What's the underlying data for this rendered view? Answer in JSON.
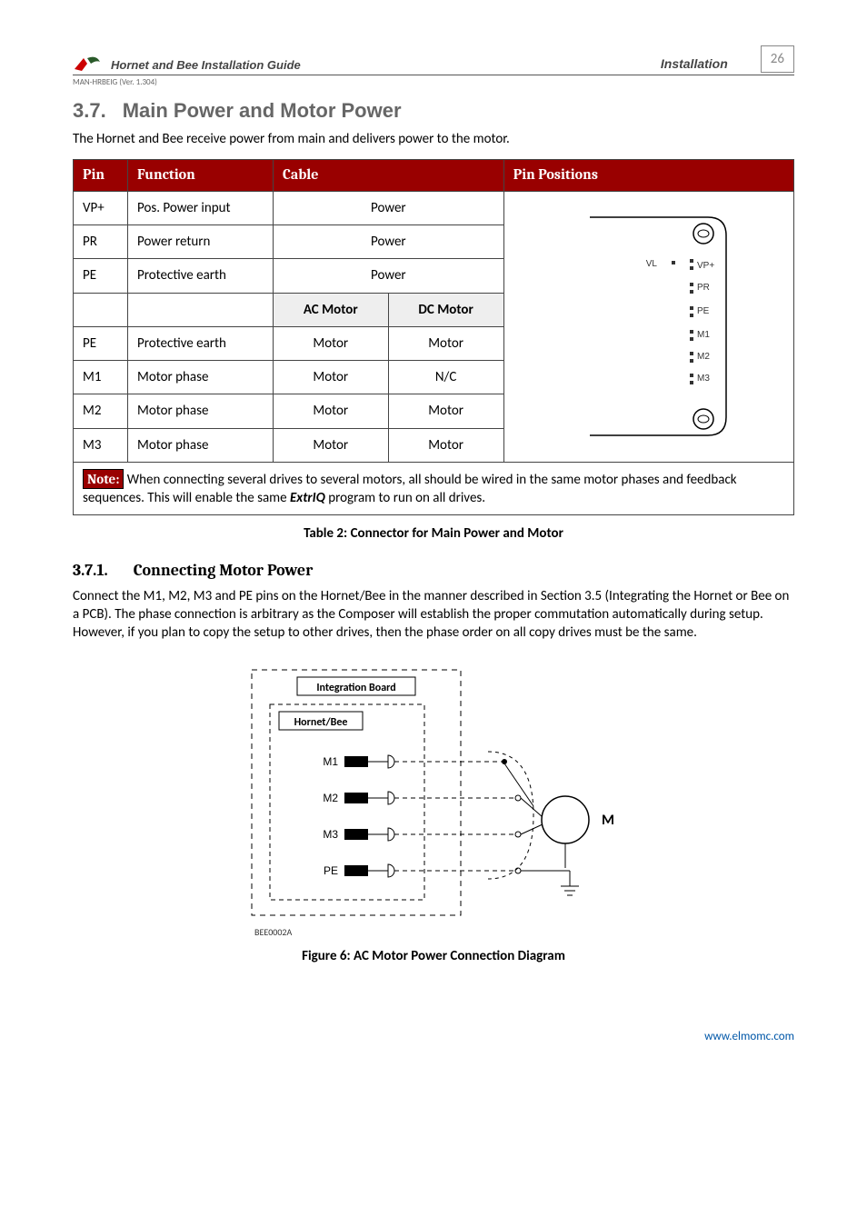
{
  "header": {
    "doc_title": "Hornet and Bee Installation Guide",
    "section": "Installation",
    "page_no": "26",
    "man_ver": "MAN-HRBEIG (Ver. 1.304)"
  },
  "section": {
    "number": "3.7.",
    "title": "Main Power and Motor Power",
    "intro": "The Hornet and Bee receive power from main and delivers power to the motor."
  },
  "table_headers": {
    "pin": "Pin",
    "function": "Function",
    "cable": "Cable",
    "positions": "Pin Positions",
    "ac": "AC Motor",
    "dc": "DC Motor"
  },
  "rows_top": [
    {
      "pin": "VP+",
      "fn": "Pos. Power input",
      "cable": "Power"
    },
    {
      "pin": "PR",
      "fn": "Power return",
      "cable": "Power"
    },
    {
      "pin": "PE",
      "fn": "Protective earth",
      "cable": "Power"
    }
  ],
  "rows_bot": [
    {
      "pin": "PE",
      "fn": "Protective earth",
      "ac": "Motor",
      "dc": "Motor"
    },
    {
      "pin": "M1",
      "fn": "Motor phase",
      "ac": "Motor",
      "dc": "N/C"
    },
    {
      "pin": "M2",
      "fn": "Motor phase",
      "ac": "Motor",
      "dc": "Motor"
    },
    {
      "pin": "M3",
      "fn": "Motor phase",
      "ac": "Motor",
      "dc": "Motor"
    }
  ],
  "note": {
    "label": "Note:",
    "text_a": " When connecting several drives to several motors, all should be wired in the same motor phases and feedback sequences. This will enable the same ",
    "em": "ExtrIQ",
    "text_b": " program to run on all drives."
  },
  "table_caption": "Table 2: Connector for Main Power and Motor",
  "subsection": {
    "number": "3.7.1.",
    "title": "Connecting Motor Power",
    "body": "Connect the M1, M2, M3 and PE pins on the Hornet/Bee in the manner described in Section 3.5 (Integrating the Hornet or Bee on a PCB). The phase connection is arbitrary as the Composer will establish the proper commutation automatically during setup. However, if you plan to copy the setup to other drives, then the phase order on all copy drives must be the same."
  },
  "fig": {
    "board_label": "Integration Board",
    "device_label": "Hornet/Bee",
    "pins": [
      "M1",
      "M2",
      "M3",
      "PE"
    ],
    "motor_label": "M",
    "code": "BEE0002A",
    "caption": "Figure 6: AC Motor Power Connection Diagram"
  },
  "pin_labels": [
    "VL",
    "VP+",
    "PR",
    "PE",
    "M1",
    "M2",
    "M3"
  ],
  "footer_url": "www.elmomc.com"
}
